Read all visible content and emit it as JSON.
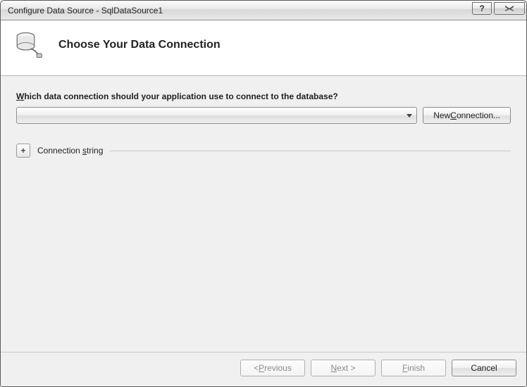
{
  "window": {
    "title": "Configure Data Source - SqlDataSource1"
  },
  "header": {
    "title": "Choose Your Data Connection"
  },
  "form": {
    "prompt_prefix": "W",
    "prompt_rest": "hich data connection should your application use to connect to the database?",
    "combo_value": "",
    "new_connection_pre": "New ",
    "new_connection_u": "C",
    "new_connection_post": "onnection...",
    "connstr_label_pre": "Connection ",
    "connstr_label_u": "s",
    "connstr_label_post": "tring",
    "expander_glyph": "+"
  },
  "footer": {
    "previous_pre": "< ",
    "previous_u": "P",
    "previous_post": "revious",
    "next_u": "N",
    "next_post": "ext >",
    "finish_u": "F",
    "finish_post": "inish",
    "cancel": "Cancel"
  },
  "help_glyph": "?"
}
